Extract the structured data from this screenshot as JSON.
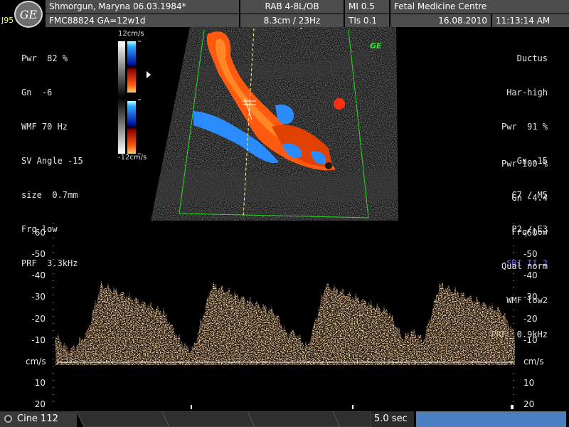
{
  "header": {
    "patient": "Shmorgun, Maryna 06.03.1984*",
    "patient_id": "FMC88824  GA=12w1d",
    "probe": "RAB 4-8L/OB",
    "depth_rate": "8.3cm / 23Hz",
    "mi": "MI  0.5",
    "tis": "TIs  0.1",
    "institution": "Fetal Medicine Centre",
    "date": "16.08.2010",
    "time": "11:13:14 AM",
    "station_tag": "J95",
    "logo_text": "GE"
  },
  "left_params": [
    "Pwr  82 %",
    "Gn  -6",
    "WMF 70 Hz",
    "SV Angle -15",
    "size  0.7mm",
    "Frq low",
    "PRF  3.3kHz"
  ],
  "right_params_top": [
    "Ductus",
    "Har-high",
    "Pwr  91 %",
    "Gn -15",
    "C7 / M5",
    "P2 / E3",
    "SRI II 2"
  ],
  "right_params_bottom": [
    "Pwr 100 %",
    "Gn -4.4",
    "Frq low",
    "Qual norm",
    "WMF low2",
    "PRF  0.9kHz"
  ],
  "color_scale": {
    "top": "12cm/s",
    "bottom": "-12cm/s"
  },
  "ge_mark": "GE",
  "doppler_axis": {
    "left_ticks": [
      {
        "label": "-60",
        "value": -60
      },
      {
        "label": "-50",
        "value": -50
      },
      {
        "label": "-40",
        "value": -40
      },
      {
        "label": "-30",
        "value": -30
      },
      {
        "label": "-20",
        "value": -20
      },
      {
        "label": "-10",
        "value": -10
      },
      {
        "label": "cm/s",
        "value": 0
      },
      {
        "label": "10",
        "value": 10
      },
      {
        "label": "20",
        "value": 20
      }
    ],
    "right_ticks": [
      {
        "label": "-60",
        "value": -60
      },
      {
        "label": "-50",
        "value": -50
      },
      {
        "label": "-40",
        "value": -40
      },
      {
        "label": "-30",
        "value": -30
      },
      {
        "label": "-20",
        "value": -20
      },
      {
        "label": "-10",
        "value": -10
      },
      {
        "label": "cm/s",
        "value": 0
      },
      {
        "label": "10",
        "value": 10
      },
      {
        "label": "20",
        "value": 20
      }
    ]
  },
  "footer": {
    "cine": "Cine 112",
    "sweep": "5.0 sec",
    "progress_fraction": 1.0
  },
  "colors": {
    "header_bg": "#4d4d4d",
    "doppler_trace": "#e8a866",
    "flow_red": "#ff5a10",
    "flow_blue": "#2a8cff",
    "progress": "#4a7fc2",
    "sri": "#6e6eff"
  }
}
